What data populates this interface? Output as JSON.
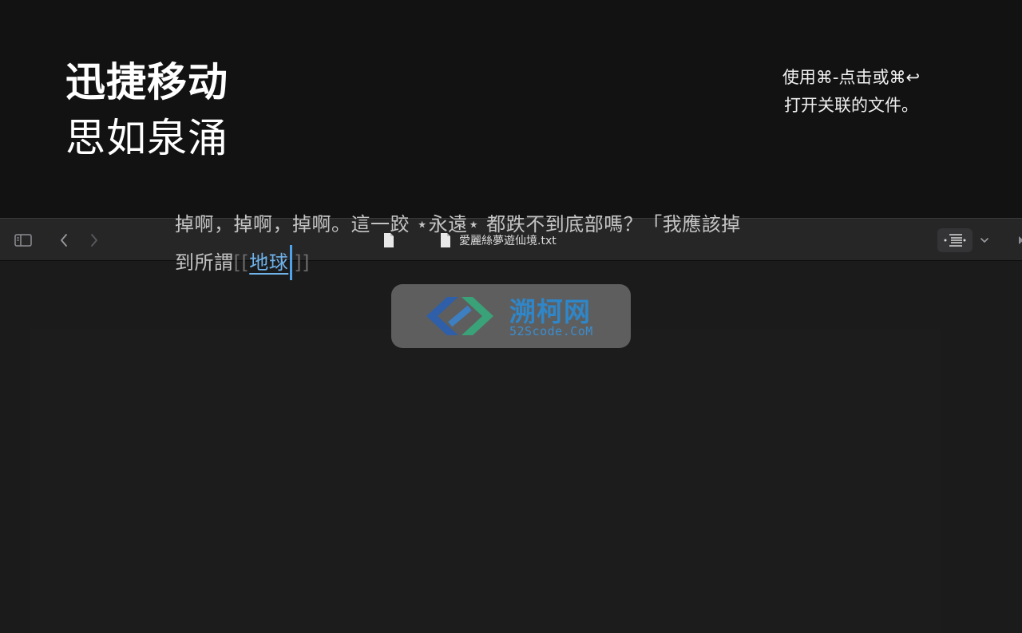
{
  "hero": {
    "title": "迅捷移动",
    "subtitle": "思如泉涌",
    "tip_line1": "使用⌘-点击或⌘↩",
    "tip_line2": "打开关联的文件。"
  },
  "toolbar": {
    "file_name": "愛麗絲夢遊仙境.txt",
    "icons": [
      "sidebar-icon",
      "chevron-left-icon",
      "chevron-right-icon",
      "document-icon",
      "outline-icon",
      "chevron-down-icon"
    ]
  },
  "editor": {
    "line1": "掉啊，掉啊，掉啊。這一跤 ⋆永遠⋆ 都跌不到底部嗎？「我應該掉",
    "line2_prefix": "到所謂",
    "open_bracket": "[[",
    "link_text": "地球",
    "close_bracket": "]]"
  },
  "watermark": {
    "name": "溯柯网",
    "domain": "52Scode.CoM"
  },
  "colors": {
    "background": "#121213",
    "toolbar": "#262627",
    "editor": "#1c1c1d",
    "link": "#6fb3ea",
    "caret": "#4fa3ea"
  }
}
